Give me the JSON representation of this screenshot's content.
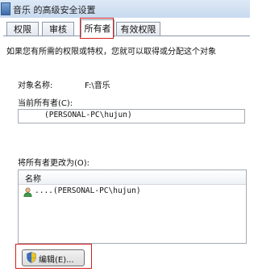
{
  "window": {
    "title": "音乐 的高级安全设置"
  },
  "tabs": [
    {
      "label": "权限"
    },
    {
      "label": "审核"
    },
    {
      "label": "所有者"
    },
    {
      "label": "有效权限"
    }
  ],
  "owner_page": {
    "description": "如果您有所需的权限或特权，您就可以取得或分配这个对象",
    "object_name_label": "对象名称:",
    "object_name_value": "F:\\音乐",
    "current_owner_label": "当前所有者(C):",
    "current_owner_value": "(PERSONAL-PC\\hujun)",
    "change_owner_label": "将所有者更改为(O):",
    "list_header": "名称",
    "list_items": [
      {
        "label": "....(PERSONAL-PC\\hujun)",
        "icon": "user-icon"
      }
    ],
    "edit_button": "编辑(E)..."
  },
  "colors": {
    "highlight": "#d51f1f",
    "titlebar": "#c8daef"
  }
}
